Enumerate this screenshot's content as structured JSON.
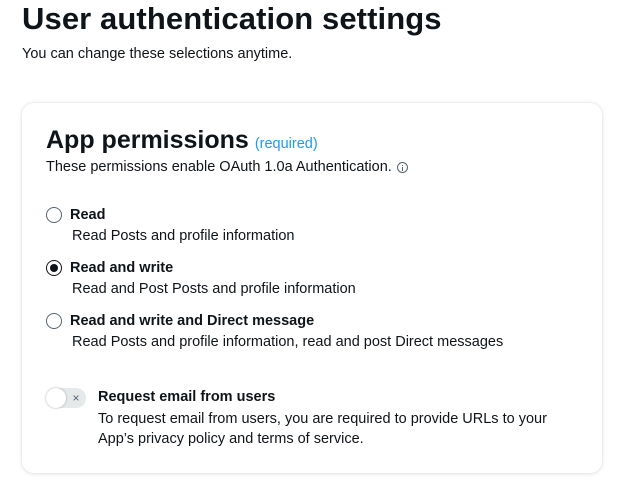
{
  "page": {
    "title": "User authentication settings",
    "subtitle": "You can change these selections anytime."
  },
  "permissions": {
    "title": "App permissions",
    "required_label": "(required)",
    "description": "These permissions enable OAuth 1.0a Authentication.",
    "info_icon": "info-icon",
    "selected": "read_write",
    "options": [
      {
        "id": "read",
        "label": "Read",
        "description": "Read Posts and profile information",
        "checked": false
      },
      {
        "id": "read_write",
        "label": "Read and write",
        "description": "Read and Post Posts and profile information",
        "checked": true
      },
      {
        "id": "read_write_dm",
        "label": "Read and write and Direct message",
        "description": "Read Posts and profile information, read and post Direct messages",
        "checked": false
      }
    ]
  },
  "email_request": {
    "label": "Request email from users",
    "description": "To request email from users, you are required to provide URLs to your App’s privacy policy and terms of service.",
    "enabled": false,
    "toggle_icon": "×"
  },
  "colors": {
    "accent": "#1d9bf0",
    "text": "#0f1419",
    "toggle_off": "#e6e9ea"
  }
}
